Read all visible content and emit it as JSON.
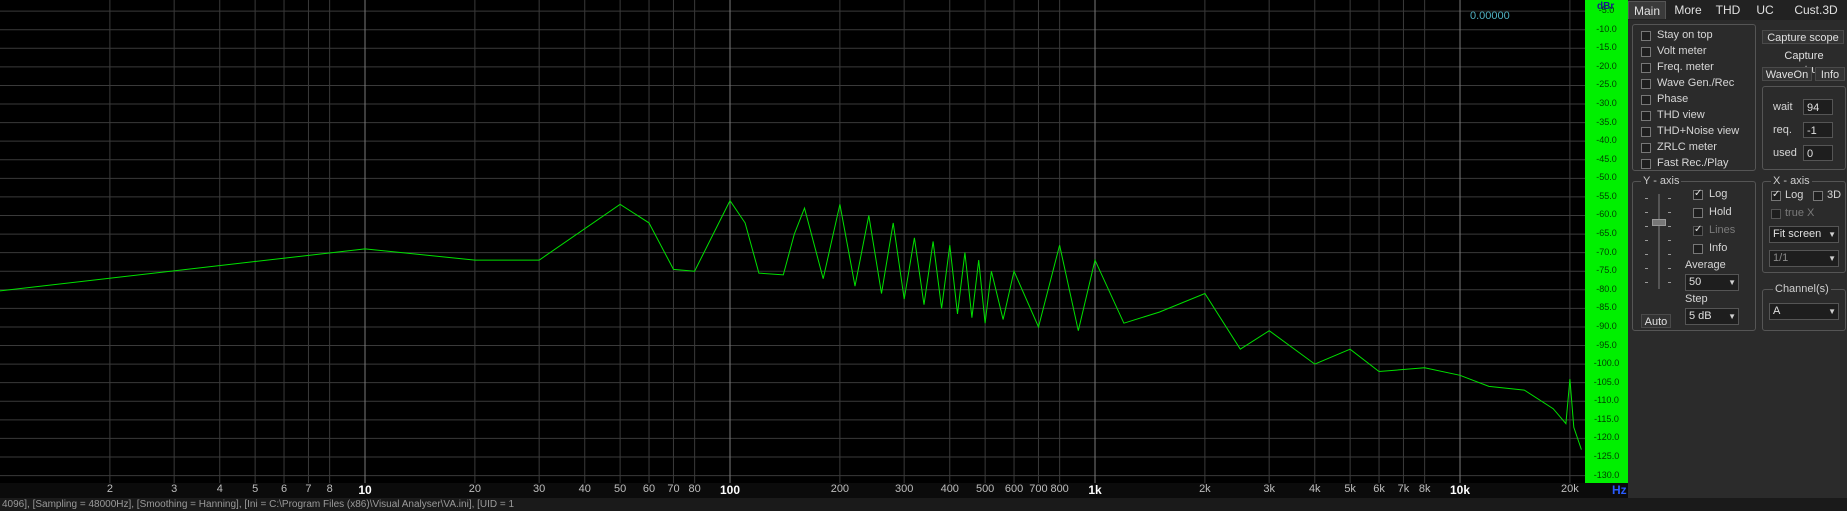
{
  "readout": "0.00000",
  "db_unit": "dBr",
  "freq_unit": "Hz",
  "db_ticks": [
    "-5.0",
    "-10.0",
    "-15.0",
    "-20.0",
    "-25.0",
    "-30.0",
    "-35.0",
    "-40.0",
    "-45.0",
    "-50.0",
    "-55.0",
    "-60.0",
    "-65.0",
    "-70.0",
    "-75.0",
    "-80.0",
    "-85.0",
    "-90.0",
    "-95.0",
    "-100.0",
    "-105.0",
    "-110.0",
    "-115.0",
    "-120.0",
    "-125.0",
    "-130.0"
  ],
  "freq_ticks": [
    {
      "f": 2,
      "label": "2"
    },
    {
      "f": 3,
      "label": "3"
    },
    {
      "f": 4,
      "label": "4"
    },
    {
      "f": 5,
      "label": "5"
    },
    {
      "f": 6,
      "label": "6"
    },
    {
      "f": 7,
      "label": "7"
    },
    {
      "f": 8,
      "label": "8"
    },
    {
      "f": 10,
      "label": "10",
      "major": true
    },
    {
      "f": 20,
      "label": "20"
    },
    {
      "f": 30,
      "label": "30"
    },
    {
      "f": 40,
      "label": "40"
    },
    {
      "f": 50,
      "label": "50"
    },
    {
      "f": 60,
      "label": "60"
    },
    {
      "f": 70,
      "label": "70"
    },
    {
      "f": 80,
      "label": "80"
    },
    {
      "f": 100,
      "label": "100",
      "major": true
    },
    {
      "f": 200,
      "label": "200"
    },
    {
      "f": 300,
      "label": "300"
    },
    {
      "f": 400,
      "label": "400"
    },
    {
      "f": 500,
      "label": "500"
    },
    {
      "f": 600,
      "label": "600"
    },
    {
      "f": 700,
      "label": "700"
    },
    {
      "f": 800,
      "label": "800"
    },
    {
      "f": 1000,
      "label": "1k",
      "major": true
    },
    {
      "f": 2000,
      "label": "2k"
    },
    {
      "f": 3000,
      "label": "3k"
    },
    {
      "f": 4000,
      "label": "4k"
    },
    {
      "f": 5000,
      "label": "5k"
    },
    {
      "f": 6000,
      "label": "6k"
    },
    {
      "f": 7000,
      "label": "7k"
    },
    {
      "f": 8000,
      "label": "8k"
    },
    {
      "f": 10000,
      "label": "10k",
      "major": true
    },
    {
      "f": 20000,
      "label": "20k"
    }
  ],
  "chart_data": {
    "type": "line",
    "x_scale": "log",
    "y_scale": "linear",
    "xlim": [
      1,
      22000
    ],
    "ylim": [
      -132,
      -2
    ],
    "grid": true,
    "x": [
      1,
      10,
      20,
      30,
      50,
      60,
      70,
      80,
      100,
      110,
      120,
      140,
      150,
      160,
      180,
      200,
      220,
      240,
      260,
      280,
      300,
      320,
      340,
      360,
      380,
      400,
      420,
      440,
      460,
      480,
      500,
      520,
      560,
      600,
      700,
      800,
      900,
      1000,
      1200,
      1500,
      2000,
      2500,
      3000,
      4000,
      5000,
      6000,
      8000,
      10000,
      12000,
      15000,
      18000,
      19500,
      20000,
      20500,
      21500
    ],
    "y": [
      -80.3,
      -69,
      -72,
      -72,
      -57,
      -62,
      -74.5,
      -75,
      -56,
      -62,
      -75.5,
      -76,
      -65,
      -58,
      -77,
      -57,
      -79,
      -60,
      -81,
      -62,
      -82.5,
      -66,
      -84,
      -67,
      -85,
      -68,
      -86.5,
      -70,
      -87.5,
      -72,
      -89,
      -75,
      -88,
      -75,
      -90,
      -68,
      -91,
      -72,
      -89,
      -86,
      -81,
      -96,
      -91,
      -100,
      -96,
      -102,
      -101,
      -103,
      -106,
      -107,
      -112,
      -116,
      -104,
      -117,
      -123
    ]
  },
  "tabs": [
    "Main",
    "More",
    "THD",
    "UC",
    "Cust.3D"
  ],
  "options": [
    {
      "label": "Stay on top",
      "checked": false
    },
    {
      "label": "Volt meter",
      "checked": false
    },
    {
      "label": "Freq. meter",
      "checked": false
    },
    {
      "label": "Wave Gen./Rec",
      "checked": false
    },
    {
      "label": "Phase",
      "checked": false
    },
    {
      "label": "THD view",
      "checked": false
    },
    {
      "label": "THD+Noise view",
      "checked": false
    },
    {
      "label": "ZRLC meter",
      "checked": false
    },
    {
      "label": "Fast Rec./Play",
      "checked": false
    }
  ],
  "buttons": {
    "capture_scope": "Capture scope",
    "capture_spectrum": "Capture spectrum",
    "wave_on": "WaveOn",
    "info": "Info",
    "auto": "Auto"
  },
  "timing": {
    "wait_label": "wait",
    "wait_value": "94",
    "req_label": "req.",
    "req_value": "-1",
    "used_label": "used",
    "used_value": "0"
  },
  "y_axis": {
    "title": "Y - axis",
    "log_label": "Log",
    "log": true,
    "hold_label": "Hold",
    "hold": false,
    "lines_label": "Lines",
    "lines": true,
    "info_label": "Info",
    "info": false,
    "average_label": "Average",
    "average_value": "50",
    "step_label": "Step",
    "step_value": "5 dB"
  },
  "x_axis": {
    "title": "X - axis",
    "log_label": "Log",
    "log": true,
    "threed_label": "3D",
    "threed": false,
    "truex_label": "true X",
    "truex": false,
    "fit_value": "Fit screen",
    "ratio_value": "1/1"
  },
  "channels": {
    "title": "Channel(s)",
    "value": "A"
  },
  "status_text": "4096], [Sampling = 48000Hz], [Smoothing = Hanning], [Ini = C:\\Program Files (x86)\\Visual Analyser\\VA.ini], [UID = 1",
  "colors": {
    "trace": "#00e000",
    "grid": "#3a3a3a",
    "db_bar": "#00f000"
  }
}
